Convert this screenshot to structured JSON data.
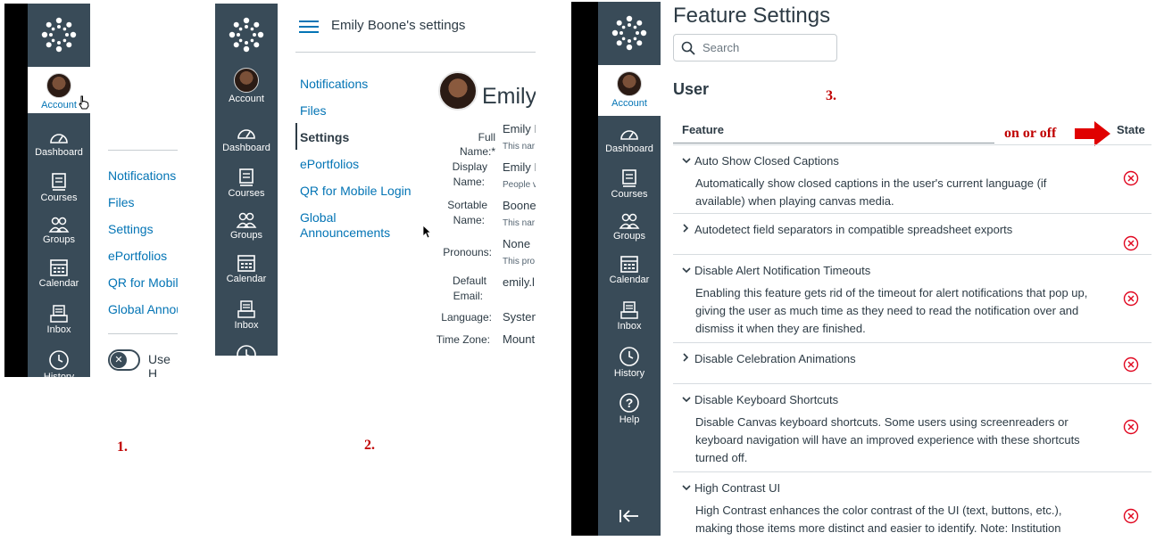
{
  "nav": {
    "account": "Account",
    "dashboard": "Dashboard",
    "courses": "Courses",
    "groups": "Groups",
    "calendar": "Calendar",
    "inbox": "Inbox",
    "history": "History",
    "help": "Help"
  },
  "panel1": {
    "links": [
      "Notifications",
      "Files",
      "Settings",
      "ePortfolios",
      "QR for Mobile",
      "Global Annou"
    ],
    "toggle_label": "Use H",
    "step": "1."
  },
  "panel2": {
    "header_title": "Emily Boone's settings",
    "links": [
      "Notifications",
      "Files",
      "Settings",
      "ePortfolios",
      "QR for Mobile Login",
      "Global",
      "Announcements"
    ],
    "name_display": "Emily",
    "fields": {
      "full_name_label": "Full Name:*",
      "full_name_value": "Emily I",
      "full_name_hint": "This nar",
      "display_label_1": "Display",
      "display_label_2": "Name:",
      "display_value": "Emily I",
      "display_hint": "People v",
      "sortable_label_1": "Sortable",
      "sortable_label_2": "Name:",
      "sortable_value": "Boone",
      "sortable_hint": "This nar",
      "pronouns_label": "Pronouns:",
      "pronouns_value": "None",
      "pronouns_hint": "This pro",
      "email_label_1": "Default",
      "email_label_2": "Email:",
      "email_value": "emily.l",
      "language_label": "Language:",
      "language_value": "Systen",
      "timezone_label": "Time Zone:",
      "timezone_value": "Mount"
    },
    "step": "2."
  },
  "panel3": {
    "title": "Feature Settings",
    "search_placeholder": "Search",
    "section": "User",
    "step": "3.",
    "col_feature": "Feature",
    "col_state": "State",
    "annotation": "on or off",
    "features": [
      {
        "name": "Auto Show Closed Captions",
        "expanded": true,
        "desc": "Automatically show closed captions in the user's current language (if available) when playing canvas media."
      },
      {
        "name": "Autodetect field separators in compatible spreadsheet exports",
        "expanded": false,
        "desc": ""
      },
      {
        "name": "Disable Alert Notification Timeouts",
        "expanded": true,
        "desc": "Enabling this feature gets rid of the timeout for alert notifications that pop up, giving the user as much time as they need to read the notification over and dismiss it when they are finished."
      },
      {
        "name": "Disable Celebration Animations",
        "expanded": false,
        "desc": ""
      },
      {
        "name": "Disable Keyboard Shortcuts",
        "expanded": true,
        "desc": "Disable Canvas keyboard shortcuts. Some users using screenreaders or keyboard navigation will have an improved experience with these shortcuts turned off."
      },
      {
        "name": "High Contrast UI",
        "expanded": true,
        "desc": "High Contrast enhances the color contrast of the UI (text, buttons, etc.), making those items more distinct and easier to identify. Note: Institution"
      }
    ]
  },
  "colors": {
    "nav_bg": "#394b58",
    "link": "#0374b5",
    "text": "#2d3b45",
    "state_off": "#e0061f",
    "annotation": "#c00000"
  }
}
